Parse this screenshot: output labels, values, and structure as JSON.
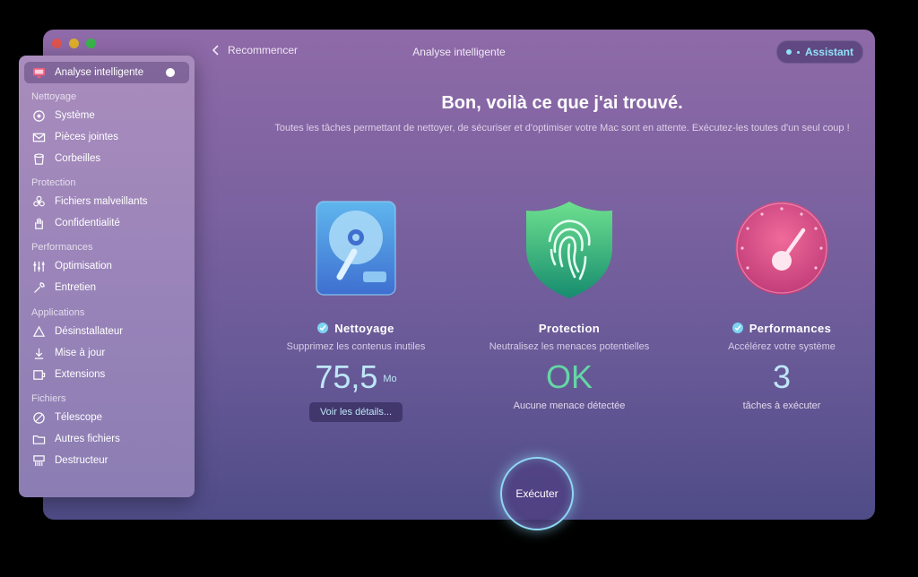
{
  "window": {
    "title": "Analyse intelligente",
    "back_label": "Recommencer",
    "assistant_label": "Assistant"
  },
  "sidebar": {
    "active": {
      "label": "Analyse intelligente",
      "icon": "monitor-icon"
    },
    "sections": [
      {
        "title": "Nettoyage",
        "items": [
          {
            "label": "Système",
            "icon": "system-icon"
          },
          {
            "label": "Pièces jointes",
            "icon": "envelope-icon"
          },
          {
            "label": "Corbeilles",
            "icon": "trash-icon"
          }
        ]
      },
      {
        "title": "Protection",
        "items": [
          {
            "label": "Fichiers malveillants",
            "icon": "biohazard-icon"
          },
          {
            "label": "Confidentialité",
            "icon": "hand-icon"
          }
        ]
      },
      {
        "title": "Performances",
        "items": [
          {
            "label": "Optimisation",
            "icon": "sliders-icon"
          },
          {
            "label": "Entretien",
            "icon": "wrench-icon"
          }
        ]
      },
      {
        "title": "Applications",
        "items": [
          {
            "label": "Désinstallateur",
            "icon": "uninstall-icon"
          },
          {
            "label": "Mise à jour",
            "icon": "update-icon"
          },
          {
            "label": "Extensions",
            "icon": "extensions-icon"
          }
        ]
      },
      {
        "title": "Fichiers",
        "items": [
          {
            "label": "Télescope",
            "icon": "lens-icon"
          },
          {
            "label": "Autres fichiers",
            "icon": "folder-icon"
          },
          {
            "label": "Destructeur",
            "icon": "shredder-icon"
          }
        ]
      }
    ]
  },
  "main": {
    "headline": "Bon, voilà ce que j'ai trouvé.",
    "subline": "Toutes les tâches permettant de nettoyer, de sécuriser et d'optimiser votre Mac sont en attente. Exécutez-les toutes d'un seul coup !",
    "cleanup": {
      "title": "Nettoyage",
      "desc": "Supprimez les contenus inutiles",
      "value": "75,5",
      "unit": "Mo",
      "details_label": "Voir les détails..."
    },
    "protection": {
      "title": "Protection",
      "desc": "Neutralisez les menaces potentielles",
      "value": "OK",
      "sub": "Aucune menace détectée"
    },
    "performance": {
      "title": "Performances",
      "desc": "Accélérez votre système",
      "value": "3",
      "sub": "tâches à exécuter"
    },
    "execute_label": "Exécuter"
  },
  "colors": {
    "accent_cyan": "#8fd8f4",
    "ok_green": "#64d6a6"
  }
}
